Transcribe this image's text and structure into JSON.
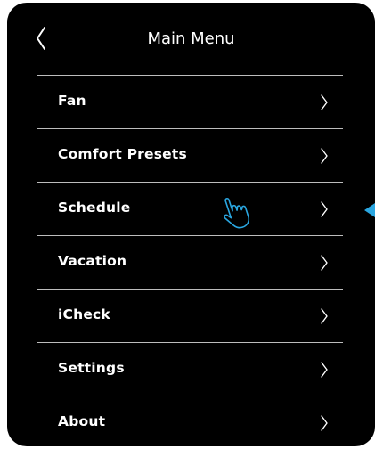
{
  "header": {
    "title": "Main Menu",
    "back_icon": "chevron-left-icon"
  },
  "menu": {
    "items": [
      {
        "label": "Fan",
        "icon": "chevron-right-icon"
      },
      {
        "label": "Comfort Presets",
        "icon": "chevron-right-icon"
      },
      {
        "label": "Schedule",
        "icon": "chevron-right-icon"
      },
      {
        "label": "Vacation",
        "icon": "chevron-right-icon"
      },
      {
        "label": "iCheck",
        "icon": "chevron-right-icon"
      },
      {
        "label": "Settings",
        "icon": "chevron-right-icon"
      },
      {
        "label": "About",
        "icon": "chevron-right-icon"
      }
    ]
  },
  "annotations": {
    "hand_icon": "pointing-hand-icon",
    "pointer_tab_icon": "arrow-tab-icon"
  },
  "colors": {
    "screen_background": "#000000",
    "text": "#ffffff",
    "divider": "#bdbdbd",
    "accent": "#2aa6e0"
  }
}
